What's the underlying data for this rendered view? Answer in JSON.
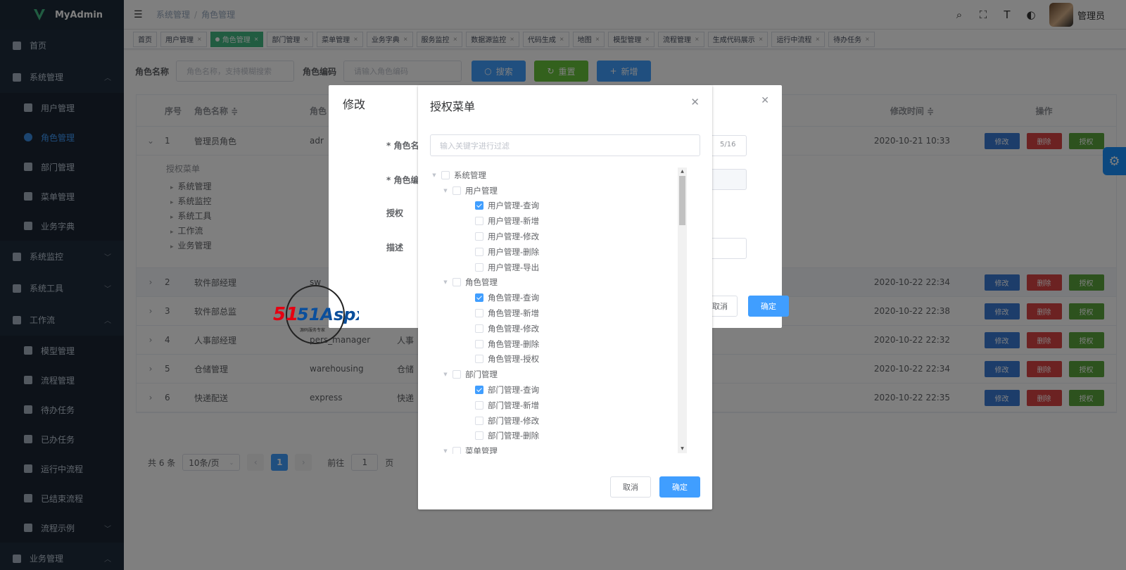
{
  "app": {
    "logo_text": "MyAdmin"
  },
  "sidebar": {
    "items": [
      {
        "label": "首页",
        "icon": "dashboard-icon",
        "type": "top"
      },
      {
        "label": "系统管理",
        "icon": "briefcase-icon",
        "type": "top",
        "arrow": "^"
      },
      {
        "label": "用户管理",
        "icon": "user-icon",
        "type": "sub"
      },
      {
        "label": "角色管理",
        "icon": "role-icon",
        "type": "sub",
        "active": true
      },
      {
        "label": "部门管理",
        "icon": "department-icon",
        "type": "sub"
      },
      {
        "label": "菜单管理",
        "icon": "list-icon",
        "type": "sub"
      },
      {
        "label": "业务字典",
        "icon": "dictionary-icon",
        "type": "sub"
      },
      {
        "label": "系统监控",
        "icon": "monitor-icon",
        "type": "top",
        "arrow": "v"
      },
      {
        "label": "系统工具",
        "icon": "toolbox-icon",
        "type": "top",
        "arrow": "v"
      },
      {
        "label": "工作流",
        "icon": "workflow-icon",
        "type": "top",
        "arrow": "^"
      },
      {
        "label": "模型管理",
        "icon": "cube-icon",
        "type": "sub"
      },
      {
        "label": "流程管理",
        "icon": "process-icon",
        "type": "sub"
      },
      {
        "label": "待办任务",
        "icon": "clipboard-icon",
        "type": "sub"
      },
      {
        "label": "已办任务",
        "icon": "clipboard-check-icon",
        "type": "sub"
      },
      {
        "label": "运行中流程",
        "icon": "play-icon",
        "type": "sub"
      },
      {
        "label": "已结束流程",
        "icon": "stop-icon",
        "type": "sub"
      },
      {
        "label": "流程示例",
        "icon": "sample-icon",
        "type": "sub",
        "arrow": "v"
      },
      {
        "label": "业务管理",
        "icon": "business-icon",
        "type": "top",
        "arrow": "^"
      }
    ]
  },
  "header": {
    "breadcrumb": [
      "系统管理",
      "角色管理"
    ],
    "user_name": "管理员"
  },
  "tags": [
    {
      "label": "首页",
      "closable": false
    },
    {
      "label": "用户管理",
      "closable": true
    },
    {
      "label": "角色管理",
      "closable": true,
      "active": true
    },
    {
      "label": "部门管理",
      "closable": true
    },
    {
      "label": "菜单管理",
      "closable": true
    },
    {
      "label": "业务字典",
      "closable": true
    },
    {
      "label": "服务监控",
      "closable": true
    },
    {
      "label": "数据源监控",
      "closable": true
    },
    {
      "label": "代码生成",
      "closable": true
    },
    {
      "label": "地图",
      "closable": true
    },
    {
      "label": "模型管理",
      "closable": true
    },
    {
      "label": "流程管理",
      "closable": true
    },
    {
      "label": "生成代码展示",
      "closable": true
    },
    {
      "label": "运行中流程",
      "closable": true
    },
    {
      "label": "待办任务",
      "closable": true
    }
  ],
  "search": {
    "name_label": "角色名称",
    "name_placeholder": "角色名称，支持模糊搜索",
    "code_label": "角色编码",
    "code_placeholder": "请输入角色编码",
    "search_btn": "搜索",
    "reset_btn": "重置",
    "add_btn": "新增"
  },
  "table": {
    "headers": {
      "no": "序号",
      "name": "角色名称 ≑",
      "code": "角色",
      "time": "修改时间 ≑",
      "ops": "操作"
    },
    "op_labels": {
      "edit": "修改",
      "delete": "删除",
      "grant": "授权"
    },
    "expanded_title": "授权菜单",
    "expanded_items": [
      "系统管理",
      "系统监控",
      "系统工具",
      "工作流",
      "业务管理"
    ],
    "rows": [
      {
        "no": "1",
        "name": "管理员角色",
        "code": "adr",
        "desc": "",
        "time": "2020-10-21 10:33"
      },
      {
        "no": "2",
        "name": "软件部经理",
        "code": "sw",
        "desc": "",
        "time": "2020-10-22 22:34"
      },
      {
        "no": "3",
        "name": "软件部总监",
        "code": "",
        "desc": "",
        "time": "2020-10-22 22:38"
      },
      {
        "no": "4",
        "name": "人事部经理",
        "code": "pers_manager",
        "desc": "人事",
        "time": "2020-10-22 22:32"
      },
      {
        "no": "5",
        "name": "仓储管理",
        "code": "warehousing",
        "desc": "仓储",
        "time": "2020-10-22 22:34"
      },
      {
        "no": "6",
        "name": "快递配送",
        "code": "express",
        "desc": "快递",
        "time": "2020-10-22 22:35"
      }
    ]
  },
  "pager": {
    "total": "共 6 条",
    "size": "10条/页",
    "page": "1",
    "goto_label": "前往",
    "goto_value": "1",
    "page_unit": "页"
  },
  "edit_dialog": {
    "title": "修改",
    "name_label": "* 角色名",
    "code_label": "* 角色编",
    "grant_label": "授权",
    "desc_label": "描述",
    "count": "5/16",
    "cancel": "取消",
    "ok": "确定"
  },
  "watermark": {
    "brand": "51Aspx",
    "slogan": "源码服务专家"
  },
  "dialog": {
    "title": "授权菜单",
    "filter_placeholder": "输入关键字进行过滤",
    "cancel": "取消",
    "ok": "确定",
    "tree": [
      {
        "label": "系统管理",
        "level": 0,
        "caret": true,
        "checked": false
      },
      {
        "label": "用户管理",
        "level": 1,
        "caret": true,
        "checked": false
      },
      {
        "label": "用户管理-查询",
        "level": 2,
        "checked": true
      },
      {
        "label": "用户管理-新增",
        "level": 2,
        "checked": false
      },
      {
        "label": "用户管理-修改",
        "level": 2,
        "checked": false
      },
      {
        "label": "用户管理-删除",
        "level": 2,
        "checked": false
      },
      {
        "label": "用户管理-导出",
        "level": 2,
        "checked": false
      },
      {
        "label": "角色管理",
        "level": 1,
        "caret": true,
        "checked": false
      },
      {
        "label": "角色管理-查询",
        "level": 2,
        "checked": true
      },
      {
        "label": "角色管理-新增",
        "level": 2,
        "checked": false
      },
      {
        "label": "角色管理-修改",
        "level": 2,
        "checked": false
      },
      {
        "label": "角色管理-删除",
        "level": 2,
        "checked": false
      },
      {
        "label": "角色管理-授权",
        "level": 2,
        "checked": false
      },
      {
        "label": "部门管理",
        "level": 1,
        "caret": true,
        "checked": false
      },
      {
        "label": "部门管理-查询",
        "level": 2,
        "checked": true
      },
      {
        "label": "部门管理-新增",
        "level": 2,
        "checked": false
      },
      {
        "label": "部门管理-修改",
        "level": 2,
        "checked": false
      },
      {
        "label": "部门管理-删除",
        "level": 2,
        "checked": false
      },
      {
        "label": "菜单管理",
        "level": 1,
        "caret": true,
        "checked": false
      }
    ]
  },
  "colors": {
    "primary": "#409eff",
    "success": "#67c23a",
    "danger": "#f56c6c",
    "tag_active": "#42b983",
    "sidebar_bg": "#1f2d3d",
    "edit_btn": "#3a7ad5",
    "delete_btn": "#d94545",
    "grant_btn": "#5aa53c"
  }
}
